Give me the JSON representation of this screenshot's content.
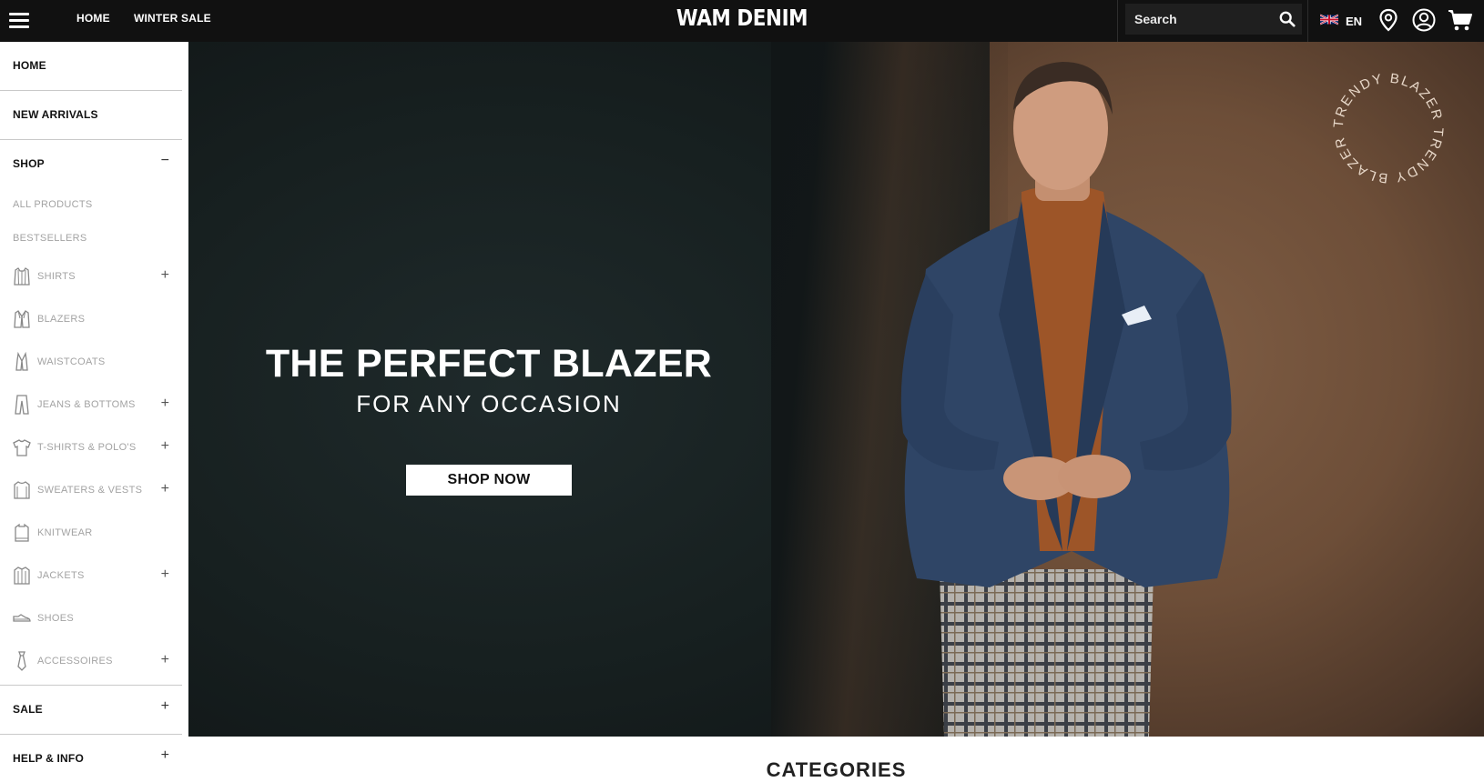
{
  "topbar": {
    "menu_icon": "hamburger-menu-icon",
    "links": [
      "HOME",
      "WINTER SALE"
    ],
    "logo": "WAM DENIM",
    "search": {
      "placeholder": "Search",
      "icon": "search-icon"
    },
    "language": {
      "flag": "uk-flag-icon",
      "code": "EN"
    },
    "icons": [
      "location-pin-icon",
      "user-account-icon",
      "shopping-cart-icon"
    ]
  },
  "sidebar": {
    "home": "HOME",
    "new_arrivals": "NEW ARRIVALS",
    "shop": {
      "label": "SHOP",
      "toggle": "−"
    },
    "shop_links": [
      "ALL PRODUCTS",
      "BESTSELLERS"
    ],
    "categories": [
      {
        "label": "SHIRTS",
        "icon": "shirt-icon",
        "toggle": "+"
      },
      {
        "label": "BLAZERS",
        "icon": "blazer-icon",
        "toggle": ""
      },
      {
        "label": "WAISTCOATS",
        "icon": "waistcoat-icon",
        "toggle": ""
      },
      {
        "label": "JEANS & BOTTOMS",
        "icon": "trousers-icon",
        "toggle": "+"
      },
      {
        "label": "T-SHIRTS & POLO'S",
        "icon": "tshirt-icon",
        "toggle": "+"
      },
      {
        "label": "SWEATERS & VESTS",
        "icon": "sweater-icon",
        "toggle": "+"
      },
      {
        "label": "KNITWEAR",
        "icon": "knitwear-icon",
        "toggle": ""
      },
      {
        "label": "JACKETS",
        "icon": "jacket-icon",
        "toggle": "+"
      },
      {
        "label": "SHOES",
        "icon": "shoe-icon",
        "toggle": ""
      },
      {
        "label": "ACCESSOIRES",
        "icon": "tie-icon",
        "toggle": "+"
      }
    ],
    "sale": {
      "label": "SALE",
      "toggle": "+"
    },
    "help": {
      "label": "HELP & INFO",
      "toggle": "+"
    }
  },
  "hero": {
    "headline": "THE PERFECT BLAZER",
    "subline": "FOR ANY OCCASION",
    "cta": "SHOP NOW",
    "badge_text": "TRENDY BLAZER TRENDY BLAZER "
  },
  "section": {
    "title": "CATEGORIES"
  }
}
